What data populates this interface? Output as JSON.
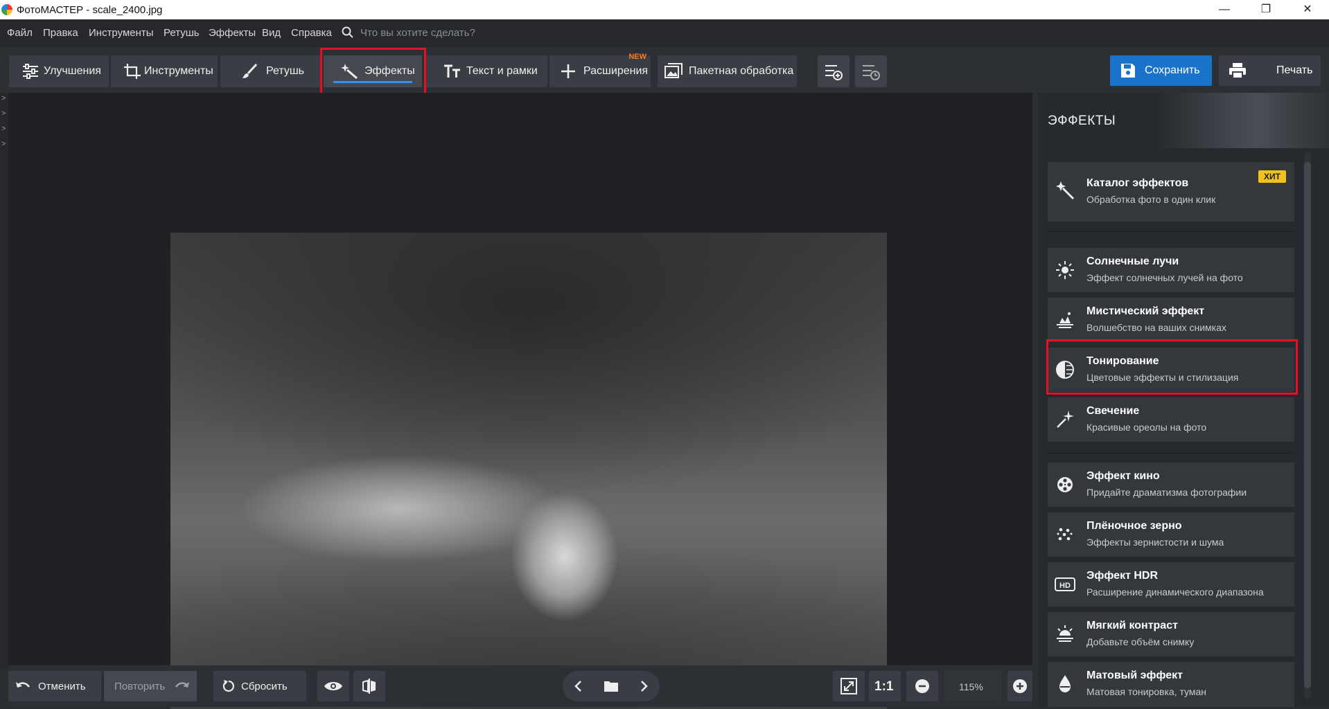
{
  "window": {
    "title": "ФотоМАСТЕР - scale_2400.jpg",
    "minimize_glyph": "—",
    "maximize_glyph": "❐",
    "close_glyph": "✕"
  },
  "menu": {
    "items": [
      "Файл",
      "Правка",
      "Инструменты",
      "Ретушь",
      "Эффекты",
      "Вид",
      "Справка"
    ],
    "search_placeholder": "Что вы хотите сделать?"
  },
  "toolbar": {
    "tabs": [
      {
        "label": "Улучшения",
        "icon": "sliders-icon"
      },
      {
        "label": "Инструменты",
        "icon": "crop-icon"
      },
      {
        "label": "Ретушь",
        "icon": "brush-icon"
      },
      {
        "label": "Эффекты",
        "icon": "magic-wand-icon",
        "active": true
      },
      {
        "label": "Текст и рамки",
        "icon": "text-icon"
      },
      {
        "label": "Расширения",
        "icon": "plus-icon",
        "badge": "NEW"
      },
      {
        "label": "Пакетная обработка",
        "icon": "images-icon"
      }
    ],
    "save_label": "Сохранить",
    "print_label": "Печать"
  },
  "panel": {
    "title": "ЭФФЕКТЫ",
    "catalog": {
      "title": "Каталог эффектов",
      "subtitle": "Обработка фото в один клик",
      "badge": "ХИТ"
    },
    "effects": [
      {
        "title": "Солнечные лучи",
        "subtitle": "Эффект солнечных лучей на фото",
        "icon": "sun-icon"
      },
      {
        "title": "Мистический эффект",
        "subtitle": "Волшебство на ваших снимках",
        "icon": "mystic-icon"
      },
      {
        "title": "Тонирование",
        "subtitle": "Цветовые эффекты и стилизация",
        "icon": "toning-icon",
        "highlighted": true
      },
      {
        "title": "Свечение",
        "subtitle": "Красивые ореолы на фото",
        "icon": "sparkle-icon"
      },
      {
        "title": "Эффект кино",
        "subtitle": "Придайте драматизма фотографии",
        "icon": "film-reel-icon"
      },
      {
        "title": "Плёночное зерно",
        "subtitle": "Эффекты зернистости и шума",
        "icon": "grain-icon"
      },
      {
        "title": "Эффект HDR",
        "subtitle": "Расширение динамического диапазона",
        "icon": "hdr-icon"
      },
      {
        "title": "Мягкий контраст",
        "subtitle": "Добавьте объём снимку",
        "icon": "soft-contrast-icon"
      },
      {
        "title": "Матовый эффект",
        "subtitle": "Матовая тонировка, туман",
        "icon": "matte-icon"
      }
    ]
  },
  "bottom": {
    "undo_label": "Отменить",
    "redo_label": "Повторить",
    "reset_label": "Сбросить",
    "zoom_one_to_one": "1:1",
    "zoom_value": "115%"
  },
  "colors": {
    "accent": "#1973c9",
    "highlight_border": "#e0141e",
    "hit_badge": "#f1c21b",
    "new_badge": "#ff7a1a"
  }
}
